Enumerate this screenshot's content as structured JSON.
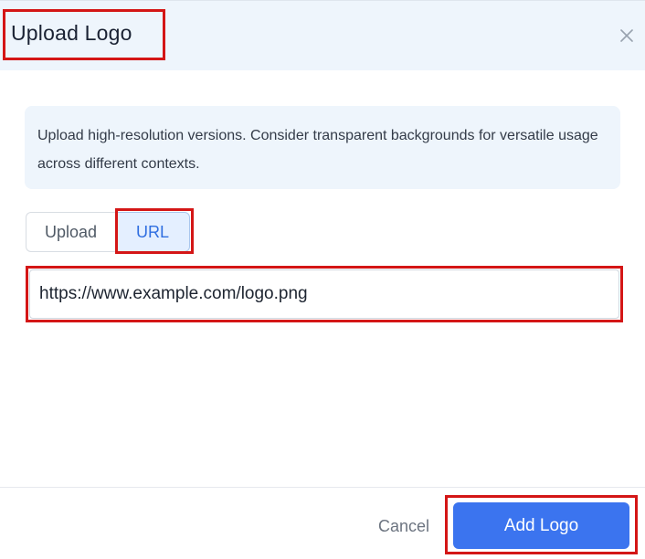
{
  "dialog": {
    "title": "Upload Logo",
    "close_icon": "close-icon"
  },
  "info": {
    "text": "Upload high-resolution versions. Consider transparent backgrounds for versatile usage across different contexts."
  },
  "tabs": [
    {
      "label": "Upload",
      "active": false
    },
    {
      "label": "URL",
      "active": true
    }
  ],
  "url_input": {
    "value": "https://www.example.com/logo.png"
  },
  "footer": {
    "cancel_label": "Cancel",
    "add_label": "Add Logo"
  },
  "colors": {
    "accent": "#3b74ef",
    "highlight": "#d41616",
    "header_bg": "#eef5fc"
  }
}
